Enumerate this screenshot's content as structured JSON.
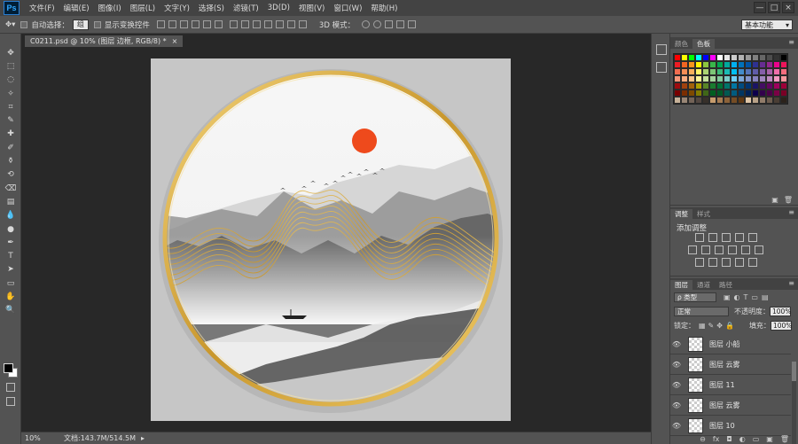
{
  "app": {
    "logo": "Ps"
  },
  "menu": [
    "文件(F)",
    "编辑(E)",
    "图像(I)",
    "图层(L)",
    "文字(Y)",
    "选择(S)",
    "滤镜(T)",
    "3D(D)",
    "视图(V)",
    "窗口(W)",
    "帮助(H)"
  ],
  "window_buttons": [
    "—",
    "□",
    "×"
  ],
  "options": {
    "auto_select_label": "自动选择：",
    "auto_select_value": "组",
    "transform_label": "显示变换控件",
    "mode_3d_label": "3D 模式：",
    "workspace": "基本功能"
  },
  "document": {
    "tab_title": "C0211.psd @ 10% (图层 边框, RGB/8) *",
    "close": "×"
  },
  "status": {
    "zoom": "10%",
    "doc_info": "文档:143.7M/514.5M"
  },
  "tools": [
    "move-icon",
    "marquee-icon",
    "lasso-icon",
    "magic-wand-icon",
    "crop-icon",
    "eyedropper-icon",
    "healing-icon",
    "brush-icon",
    "stamp-icon",
    "history-brush-icon",
    "eraser-icon",
    "gradient-icon",
    "blur-icon",
    "dodge-icon",
    "pen-icon",
    "type-icon",
    "path-select-icon",
    "shape-icon",
    "hand-icon",
    "zoom-icon"
  ],
  "tool_glyphs": [
    "✥",
    "⬚",
    "◌",
    "✧",
    "⌗",
    "✎",
    "✚",
    "✐",
    "⚱",
    "⟲",
    "⌫",
    "▤",
    "💧",
    "●",
    "✒",
    "T",
    "➤",
    "▭",
    "✋",
    "🔍"
  ],
  "colors": {
    "foreground": "#000000",
    "background": "#ffffff",
    "sun": "#ee4a1c",
    "gold": "#e0b23a"
  },
  "swatch_panel": {
    "tabs": [
      "颜色",
      "色板"
    ],
    "active": 1
  },
  "adjust_panel": {
    "tabs": [
      "调整",
      "样式"
    ],
    "active": 0,
    "title": "添加调整"
  },
  "layers_panel": {
    "tabs": [
      "图层",
      "通道",
      "路径"
    ],
    "active": 0,
    "filter": "ρ 类型",
    "blend_mode": "正常",
    "opacity_label": "不透明度：",
    "opacity": "100%",
    "lock_label": "锁定：",
    "fill_label": "填充：",
    "fill": "100%",
    "layers": [
      "图层 小船",
      "图层 云雾",
      "图层 11",
      "图层 云雾",
      "图层 10"
    ],
    "footer": [
      "⊖",
      "fx",
      "◘",
      "◐",
      "▭",
      "▣",
      "🗑"
    ]
  }
}
